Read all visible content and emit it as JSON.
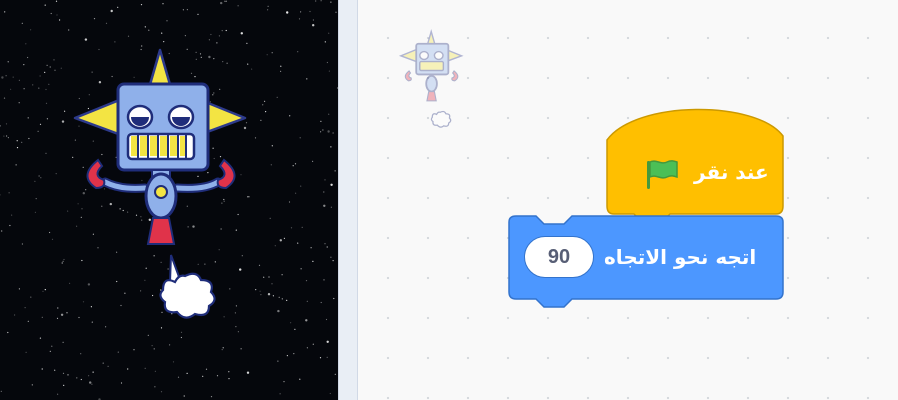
{
  "stage": {
    "sprite_name": "robot-sprite",
    "background": "starfield"
  },
  "workspace": {
    "event_block": {
      "label": "عند نقر",
      "icon": "green-flag-icon",
      "color": "#ffbf00"
    },
    "motion_block": {
      "label": "اتجه نحو الاتجاه",
      "value": "90",
      "color": "#4c97ff"
    }
  }
}
